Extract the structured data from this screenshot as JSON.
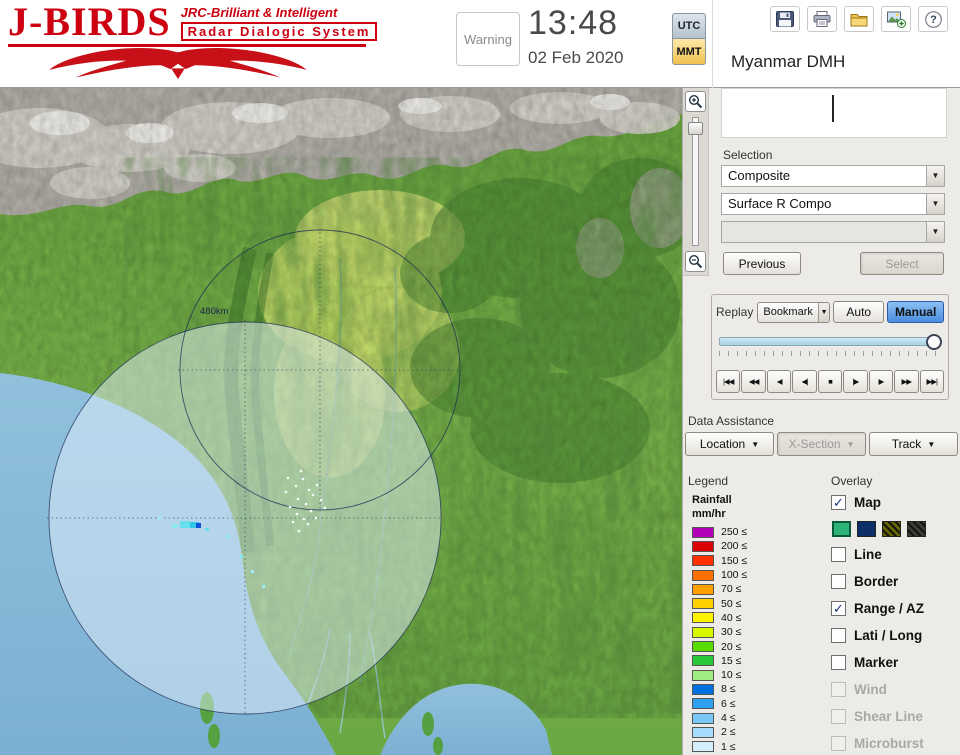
{
  "header": {
    "logo": {
      "title": "J-BIRDS",
      "subtitle1": "JRC-Brilliant & Intelligent",
      "subtitle2": "Radar  Dialogic  System"
    },
    "warning_label": "Warning",
    "time": "13:48",
    "date": "02 Feb 2020",
    "tz": {
      "utc": "UTC",
      "mmt": "MMT",
      "active": "MMT"
    },
    "site_title": "Myanmar DMH",
    "toolbar_icons": [
      "save-icon",
      "print-icon",
      "folder-icon",
      "export-image-icon",
      "help-icon"
    ]
  },
  "map": {
    "range_label": "480km"
  },
  "panel": {
    "selection_label": "Selection",
    "dropdowns": [
      {
        "value": "Composite"
      },
      {
        "value": "Surface R Compo"
      },
      {
        "value": ""
      }
    ],
    "previous_label": "Previous",
    "select_label": "Select",
    "replay": {
      "title": "Replay",
      "bookmark": "Bookmark",
      "auto": "Auto",
      "manual": "Manual",
      "active_mode": "Manual"
    },
    "playback": [
      {
        "glyph": "|◀◀",
        "name": "skip-to-start"
      },
      {
        "glyph": "◀◀",
        "name": "fast-rewind"
      },
      {
        "glyph": "◀",
        "name": "play-backward"
      },
      {
        "glyph": "◀|",
        "name": "step-backward"
      },
      {
        "glyph": "■",
        "name": "stop"
      },
      {
        "glyph": "|▶",
        "name": "step-forward"
      },
      {
        "glyph": "▶",
        "name": "play-forward"
      },
      {
        "glyph": "▶▶",
        "name": "fast-forward"
      },
      {
        "glyph": "▶▶|",
        "name": "skip-to-end"
      }
    ],
    "data_assistance": {
      "title": "Data Assistance",
      "buttons": [
        {
          "label": "Location",
          "enabled": true
        },
        {
          "label": "X-Section",
          "enabled": false
        },
        {
          "label": "Track",
          "enabled": true
        }
      ]
    },
    "legend": {
      "title": "Legend",
      "unit_line1": "Rainfall",
      "unit_line2": "mm/hr",
      "items": [
        {
          "label": "250 ≤",
          "color": "#b400b8"
        },
        {
          "label": "200 ≤",
          "color": "#dc0000"
        },
        {
          "label": "150 ≤",
          "color": "#ff3000"
        },
        {
          "label": "100 ≤",
          "color": "#ff7000"
        },
        {
          "label": "70 ≤",
          "color": "#ffa000"
        },
        {
          "label": "50 ≤",
          "color": "#ffd000"
        },
        {
          "label": "40 ≤",
          "color": "#fff400"
        },
        {
          "label": "30 ≤",
          "color": "#d8f800"
        },
        {
          "label": "20 ≤",
          "color": "#58dc00"
        },
        {
          "label": "15 ≤",
          "color": "#28c838"
        },
        {
          "label": "10 ≤",
          "color": "#a0ec80"
        },
        {
          "label": "8 ≤",
          "color": "#0070e0"
        },
        {
          "label": "6 ≤",
          "color": "#30a0f0"
        },
        {
          "label": "4 ≤",
          "color": "#78c8f8"
        },
        {
          "label": "2 ≤",
          "color": "#a8dcfc"
        },
        {
          "label": "1 ≤",
          "color": "#d4eefc"
        }
      ]
    },
    "overlay": {
      "title": "Overlay",
      "swatches": [
        {
          "color": "#2eb478",
          "selected": true
        },
        {
          "color": "#0c2f66"
        },
        {
          "color": "#646400",
          "hatch": true
        },
        {
          "color": "#3c3c3c",
          "hatch": true
        }
      ],
      "items": [
        {
          "label": "Map",
          "checked": true,
          "enabled": true
        },
        {
          "type": "swatches"
        },
        {
          "label": "Line",
          "checked": false,
          "enabled": true
        },
        {
          "label": "Border",
          "checked": false,
          "enabled": true
        },
        {
          "label": "Range / AZ",
          "checked": true,
          "enabled": true
        },
        {
          "label": "Lati / Long",
          "checked": false,
          "enabled": true
        },
        {
          "label": "Marker",
          "checked": false,
          "enabled": true
        },
        {
          "label": "Wind",
          "checked": false,
          "enabled": false
        },
        {
          "label": "Shear Line",
          "checked": false,
          "enabled": false
        },
        {
          "label": "Microburst",
          "checked": false,
          "enabled": false
        }
      ]
    }
  }
}
